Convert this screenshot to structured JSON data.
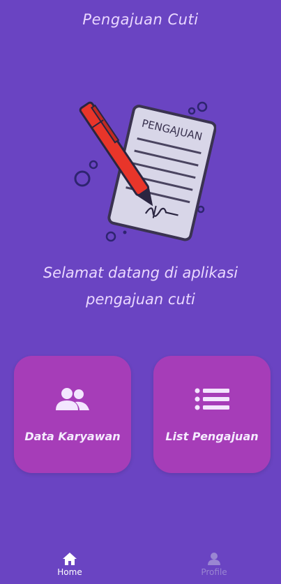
{
  "header": {
    "title": "Pengajuan Cuti"
  },
  "hero": {
    "document_heading": "PENGAJUAN"
  },
  "welcome": {
    "line1": "Selamat datang di aplikasi",
    "line2": "pengajuan cuti"
  },
  "cards": [
    {
      "label": "Data Karyawan",
      "icon": "people-icon"
    },
    {
      "label": "List Pengajuan",
      "icon": "list-icon"
    }
  ],
  "bottom_nav": {
    "items": [
      {
        "label": "Home",
        "icon": "home-icon",
        "active": true
      },
      {
        "label": "Profile",
        "icon": "person-icon",
        "active": false
      }
    ]
  },
  "colors": {
    "background": "#6a44c2",
    "card": "#a63db8",
    "text_light": "#ead8ff",
    "nav_inactive": "#9a86d2"
  }
}
